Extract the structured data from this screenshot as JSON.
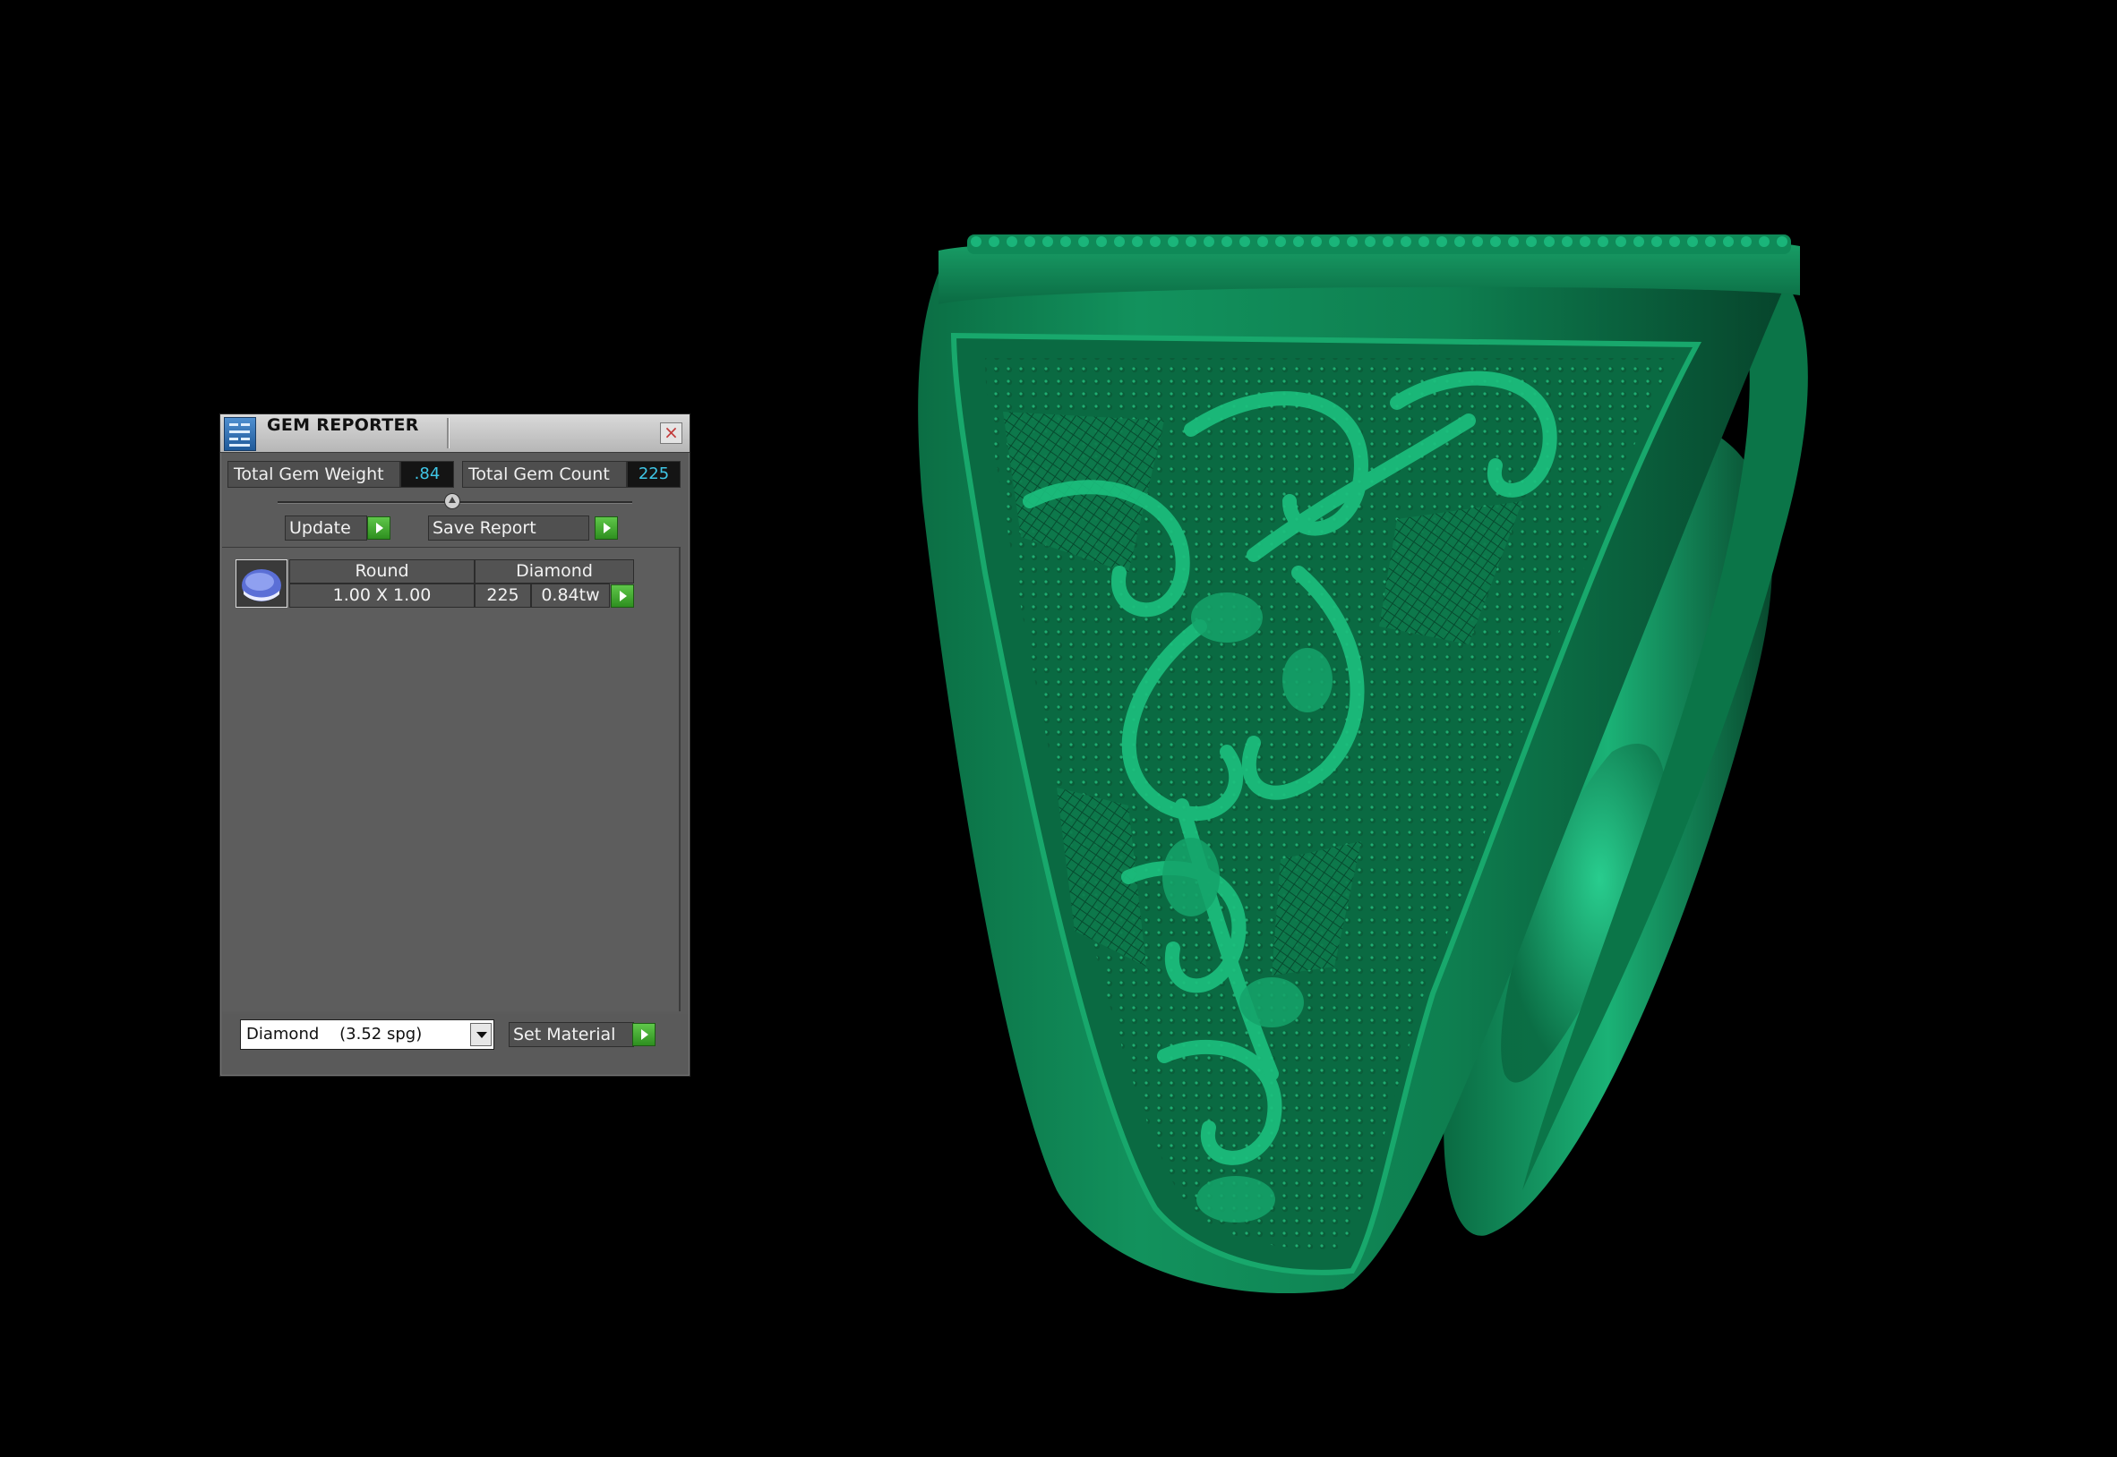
{
  "panel": {
    "title": "GEM REPORTER",
    "close_glyph": "×",
    "icons": {
      "app": "gem-reporter-app-icon",
      "close": "close-icon",
      "run": "green-play-arrow-icon",
      "thumbnail": "round-gem-icon",
      "dropdown": "chevron-down-icon"
    },
    "stats": {
      "weight_label": "Total Gem Weight",
      "weight_value": ".84",
      "count_label": "Total Gem Count",
      "count_value": "225"
    },
    "buttons": {
      "update": "Update",
      "save_report": "Save Report",
      "set_material": "Set Material"
    },
    "gems": [
      {
        "shape": "Round",
        "material": "Diamond",
        "size": "1.00 X 1.00",
        "count": "225",
        "weight": "0.84tw"
      }
    ],
    "material_select": "Diamond    (3.52 spg)"
  },
  "colors": {
    "accent_value": "#3fc6e6",
    "go_button": "#3fa82e",
    "ring_model": "#0f8a58",
    "background": "#000000"
  }
}
